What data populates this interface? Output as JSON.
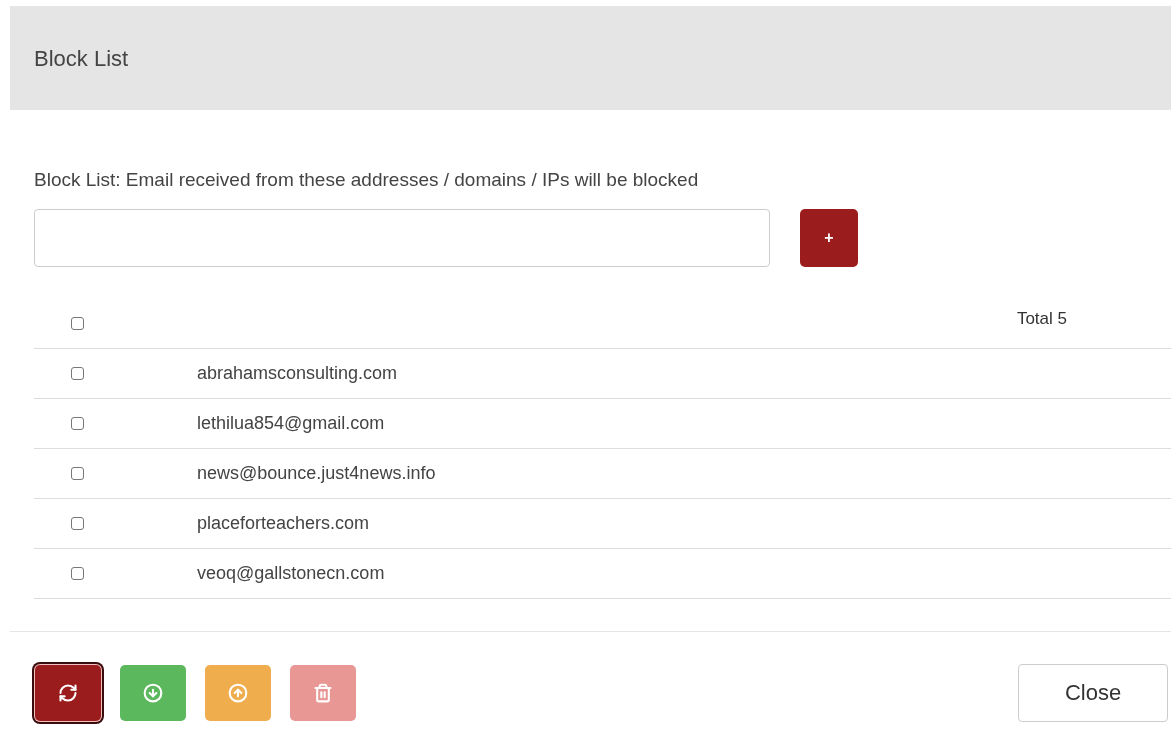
{
  "header": {
    "title": "Block List"
  },
  "description": "Block List: Email received from these addresses / domains / IPs will be blocked",
  "add_button": {
    "label": "+"
  },
  "table": {
    "header": {
      "checked": false,
      "total": "Total 5"
    },
    "rows": [
      {
        "address": "abrahamsconsulting.com",
        "checked": false
      },
      {
        "address": "lethilua854@gmail.com",
        "checked": false
      },
      {
        "address": "news@bounce.just4news.info",
        "checked": false
      },
      {
        "address": "placeforteachers.com",
        "checked": false
      },
      {
        "address": "veoq@gallstonecn.com",
        "checked": false
      }
    ]
  },
  "actions": [
    {
      "kind": "refresh",
      "focused": true,
      "disabled": false
    },
    {
      "kind": "download",
      "focused": false,
      "disabled": false
    },
    {
      "kind": "upload",
      "focused": false,
      "disabled": false
    },
    {
      "kind": "delete",
      "focused": false,
      "disabled": true
    }
  ],
  "close_button": {
    "label": "Close"
  }
}
